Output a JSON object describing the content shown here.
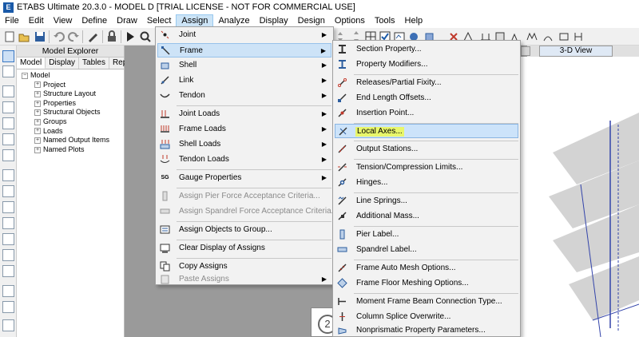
{
  "window": {
    "logo_letter": "E",
    "title": "ETABS Ultimate 20.3.0 - MODEL D  [TRIAL LICENSE - NOT FOR COMMERCIAL USE]"
  },
  "menubar": [
    "File",
    "Edit",
    "View",
    "Define",
    "Draw",
    "Select",
    "Assign",
    "Analyze",
    "Display",
    "Design",
    "Options",
    "Tools",
    "Help"
  ],
  "model_explorer": {
    "title": "Model Explorer",
    "tabs": [
      "Model",
      "Display",
      "Tables",
      "Reports"
    ],
    "root": "Model",
    "items": [
      "Project",
      "Structure Layout",
      "Properties",
      "Structural Objects",
      "Groups",
      "Loads",
      "Named Output Items",
      "Named Plots"
    ]
  },
  "view_3d": {
    "tab_label": "3-D View"
  },
  "plan_view": {
    "grid_label": "2"
  },
  "assign_menu": [
    {
      "label": "Joint",
      "icon": "joint-icon",
      "submenu": true
    },
    {
      "label": "Frame",
      "icon": "frame-icon",
      "submenu": true,
      "highlighted": true
    },
    {
      "label": "Shell",
      "icon": "shell-icon",
      "submenu": true
    },
    {
      "label": "Link",
      "icon": "link-icon",
      "submenu": true
    },
    {
      "label": "Tendon",
      "icon": "tendon-icon",
      "submenu": true
    },
    {
      "label": "Joint Loads",
      "icon": "joint-loads-icon",
      "submenu": true
    },
    {
      "label": "Frame Loads",
      "icon": "frame-loads-icon",
      "submenu": true
    },
    {
      "label": "Shell Loads",
      "icon": "shell-loads-icon",
      "submenu": true
    },
    {
      "label": "Tendon Loads",
      "icon": "tendon-loads-icon",
      "submenu": true
    },
    {
      "label": "Gauge Properties",
      "icon": "gauge-icon",
      "icon_text": "SG",
      "submenu": true
    },
    {
      "label": "Assign Pier Force Acceptance Criteria...",
      "icon": "pier-force-icon",
      "disabled": true
    },
    {
      "label": "Assign Spandrel Force Acceptance Criteria...",
      "icon": "spandrel-force-icon",
      "disabled": true
    },
    {
      "label": "Assign Objects to Group...",
      "icon": "group-icon"
    },
    {
      "label": "Clear Display of Assigns",
      "icon": "clear-display-icon"
    },
    {
      "label": "Copy Assigns",
      "icon": "copy-icon"
    },
    {
      "label": "Paste Assigns",
      "icon": "paste-icon",
      "disabled": true,
      "submenu": true
    }
  ],
  "frame_submenu": [
    {
      "label": "Section Property...",
      "icon": "section-property-icon"
    },
    {
      "label": "Property Modifiers...",
      "icon": "property-modifiers-icon"
    },
    {
      "label": "Releases/Partial Fixity...",
      "icon": "releases-icon"
    },
    {
      "label": "End Length Offsets...",
      "icon": "end-offsets-icon"
    },
    {
      "label": "Insertion Point...",
      "icon": "insertion-point-icon"
    },
    {
      "label": "Local Axes...",
      "icon": "local-axes-icon",
      "highlighted": true
    },
    {
      "label": "Output Stations...",
      "icon": "output-stations-icon"
    },
    {
      "label": "Tension/Compression Limits...",
      "icon": "tension-compression-icon"
    },
    {
      "label": "Hinges...",
      "icon": "hinges-icon"
    },
    {
      "label": "Line Springs...",
      "icon": "line-springs-icon"
    },
    {
      "label": "Additional Mass...",
      "icon": "additional-mass-icon"
    },
    {
      "label": "Pier Label...",
      "icon": "pier-label-icon"
    },
    {
      "label": "Spandrel Label...",
      "icon": "spandrel-label-icon"
    },
    {
      "label": "Frame Auto Mesh Options...",
      "icon": "auto-mesh-icon"
    },
    {
      "label": "Frame Floor Meshing Options...",
      "icon": "floor-meshing-icon"
    },
    {
      "label": "Moment Frame Beam Connection Type...",
      "icon": "beam-connection-icon"
    },
    {
      "label": "Column Splice Overwrite...",
      "icon": "column-splice-icon"
    },
    {
      "label": "Nonprismatic Property Parameters...",
      "icon": "nonprismatic-icon"
    }
  ],
  "colors": {
    "menu_highlight": "#cde3f7",
    "text_highlight": "#e8f66b",
    "structure_line": "#3344aa",
    "explorer_bg": "#ffffff"
  }
}
